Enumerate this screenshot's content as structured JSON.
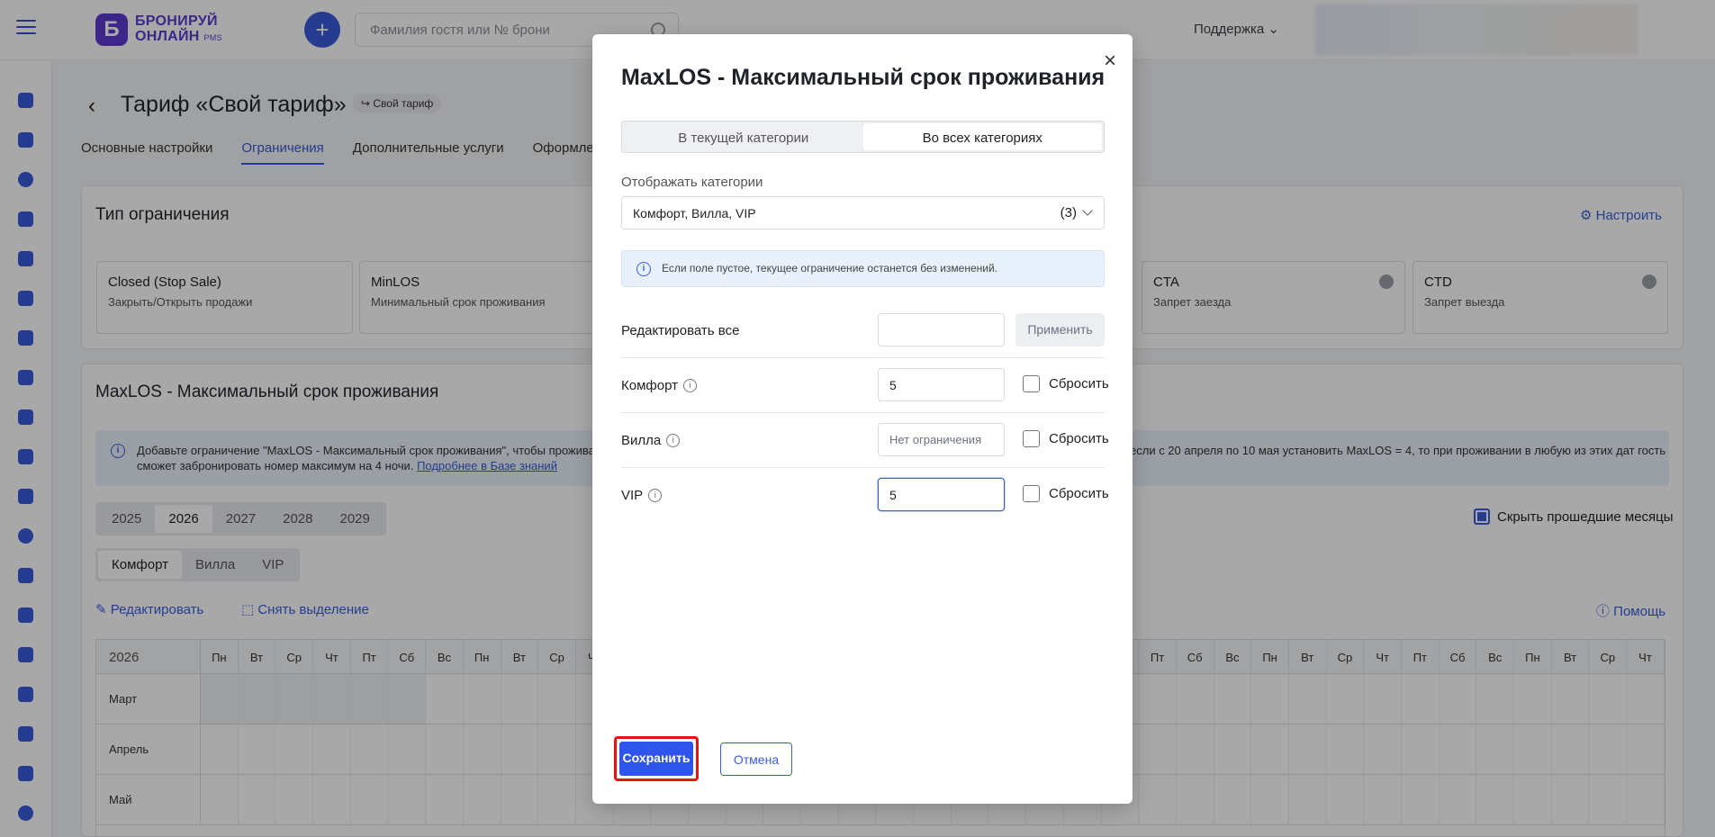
{
  "header": {
    "logo_line1": "БРОНИРУЙ",
    "logo_line2": "ОНЛАЙН",
    "logo_pms": "PMS",
    "logo_mark": "Б",
    "plus": "+",
    "search_placeholder": "Фамилия гостя или № брони",
    "support": "Поддержка ⌄"
  },
  "page": {
    "back": "‹",
    "title": "Тариф «Свой тариф»",
    "chip": "↪ Свой тариф",
    "tabs": [
      "Основные настройки",
      "Ограничения",
      "Дополнительные услуги",
      "Оформле"
    ],
    "restriction_type_title": "Тип ограничения",
    "configure": "⚙ Настроить",
    "types": [
      {
        "h": "Closed (Stop Sale)",
        "s": "Закрыть/Открыть продажи"
      },
      {
        "h": "MinLOS",
        "s": "Минимальный срок проживания"
      },
      {
        "h": "CTA",
        "s": "Запрет заезда"
      },
      {
        "h": "CTD",
        "s": "Запрет выезда"
      }
    ],
    "section_title": "MaxLOS - Максимальный срок проживания",
    "banner_left": "Добавьте ограничение \"MaxLOS - Максимальный срок проживания\", чтобы проживани",
    "banner_right": "если с 20 апреля по 10 мая установить MaxLOS = 4, то при проживании в любую из этих дат гость",
    "banner_line2": "сможет забронировать номер максимум на 4 ночи.",
    "banner_link": "Подробнее в Базе знаний",
    "years": [
      "2025",
      "2026",
      "2027",
      "2028",
      "2029"
    ],
    "categories": [
      "Комфорт",
      "Вилла",
      "VIP"
    ],
    "edit": "✎ Редактировать",
    "deselect": "⬚ Снять выделение",
    "hide_months": "Скрыть прошедшие месяцы",
    "help": "ⓘ Помощь",
    "grid_year": "2026",
    "weekdays": [
      "Пн",
      "Вт",
      "Ср",
      "Чт",
      "Пт",
      "Сб",
      "Вс",
      "Пн",
      "Вт",
      "Ср",
      "Чт",
      "Пт",
      "Сб",
      "Вс",
      "Пн",
      "Вт",
      "Ср",
      "Чт",
      "Пт",
      "Сб",
      "Вс",
      "Пн",
      "Вт",
      "Ср",
      "Чт",
      "Пт",
      "Сб",
      "Вс",
      "Пн",
      "Вт",
      "Ср",
      "Чт",
      "Пт",
      "Сб",
      "Вс",
      "Пн",
      "Вт",
      "Ср",
      "Чт"
    ],
    "months": [
      "Март",
      "Апрель",
      "Май"
    ]
  },
  "modal": {
    "title": "MaxLOS - Максимальный срок проживания",
    "close": "×",
    "tab_current": "В текущей категории",
    "tab_all": "Во всех категориях",
    "display_label": "Отображать категории",
    "display_value": "Комфорт, Вилла, VIP",
    "display_count": "(3)",
    "info": "Если поле пустое, текущее ограничение останется без изменений.",
    "edit_all_label": "Редактировать все",
    "edit_all_value": "",
    "apply": "Применить",
    "rows": [
      {
        "label": "Комфорт",
        "value": "5",
        "reset": "Сбросить"
      },
      {
        "label": "Вилла",
        "placeholder": "Нет ограничения",
        "reset": "Сбросить"
      },
      {
        "label": "VIP",
        "value": "5",
        "reset": "Сбросить"
      }
    ],
    "save": "Сохранить",
    "cancel": "Отмена"
  },
  "colors": {
    "accent": "#3b5bdb",
    "brand": "#5b3bd1",
    "highlight": "#e11111"
  }
}
